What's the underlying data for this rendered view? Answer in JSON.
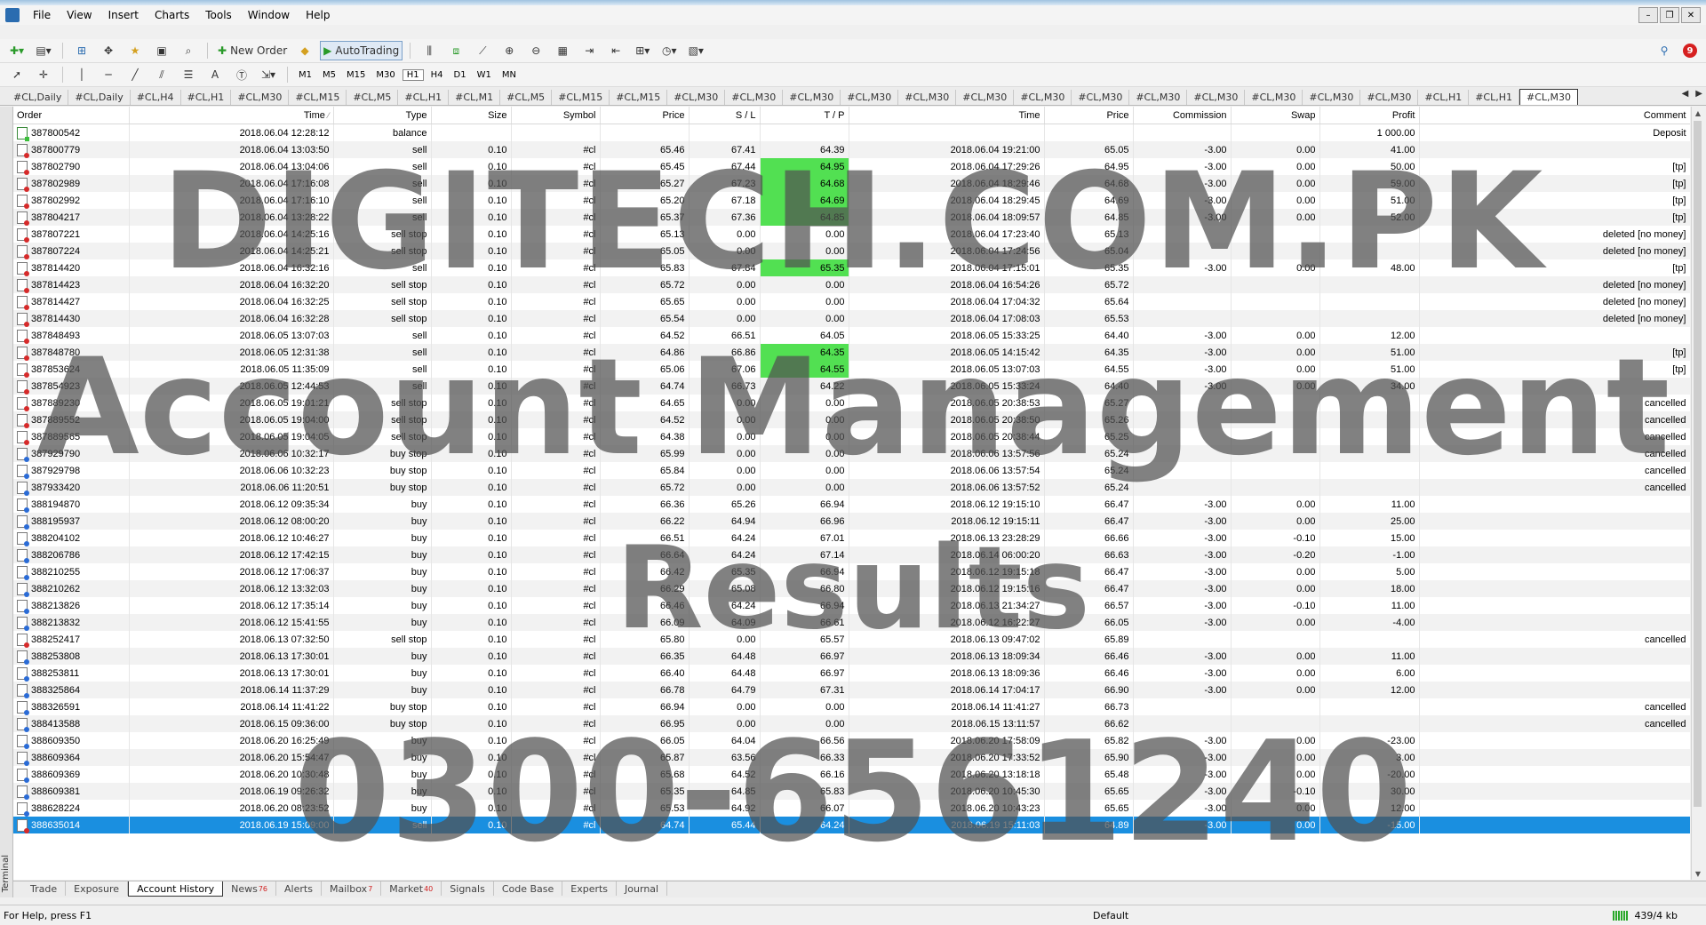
{
  "menu": [
    "File",
    "View",
    "Insert",
    "Charts",
    "Tools",
    "Window",
    "Help"
  ],
  "toolbar": {
    "new_order": "New Order",
    "autotrading": "AutoTrading",
    "notification_count": "9"
  },
  "timeframes": [
    "M1",
    "M5",
    "M15",
    "M30",
    "H1",
    "H4",
    "D1",
    "W1",
    "MN"
  ],
  "selected_timeframe": "H1",
  "chart_tabs": [
    "#CL,Daily",
    "#CL,Daily",
    "#CL,H4",
    "#CL,H1",
    "#CL,M30",
    "#CL,M15",
    "#CL,M5",
    "#CL,H1",
    "#CL,M1",
    "#CL,M5",
    "#CL,M15",
    "#CL,M15",
    "#CL,M30",
    "#CL,M30",
    "#CL,M30",
    "#CL,M30",
    "#CL,M30",
    "#CL,M30",
    "#CL,M30",
    "#CL,M30",
    "#CL,M30",
    "#CL,M30",
    "#CL,M30",
    "#CL,M30",
    "#CL,M30",
    "#CL,H1",
    "#CL,H1",
    "#CL,M30"
  ],
  "active_chart_tab": 27,
  "columns": [
    "Order",
    "Time",
    "Type",
    "Size",
    "Symbol",
    "Price",
    "S / L",
    "T / P",
    "Time",
    "Price",
    "Commission",
    "Swap",
    "Profit",
    "Comment"
  ],
  "rows": [
    {
      "order": "387800542",
      "time": "2018.06.04 12:28:12",
      "type": "balance",
      "size": "",
      "symbol": "",
      "price": "",
      "sl": "",
      "tp": "",
      "ctime": "",
      "cprice": "",
      "comm": "",
      "swap": "",
      "profit": "1 000.00",
      "comment": "Deposit"
    },
    {
      "order": "387800779",
      "time": "2018.06.04 13:03:50",
      "type": "sell",
      "size": "0.10",
      "symbol": "#cl",
      "price": "65.46",
      "sl": "67.41",
      "tp": "64.39",
      "ctime": "2018.06.04 19:21:00",
      "cprice": "65.05",
      "comm": "-3.00",
      "swap": "0.00",
      "profit": "41.00",
      "comment": ""
    },
    {
      "order": "387802790",
      "time": "2018.06.04 13:04:06",
      "type": "sell",
      "size": "0.10",
      "symbol": "#cl",
      "price": "65.45",
      "sl": "67.44",
      "tp": "64.95",
      "ctime": "2018.06.04 17:29:26",
      "cprice": "64.95",
      "comm": "-3.00",
      "swap": "0.00",
      "profit": "50.00",
      "comment": "[tp]",
      "hl": true
    },
    {
      "order": "387802989",
      "time": "2018.06.04 17:16:08",
      "type": "sell",
      "size": "0.10",
      "symbol": "#cl",
      "price": "65.27",
      "sl": "67.23",
      "tp": "64.68",
      "ctime": "2018.06.04 18:29:46",
      "cprice": "64.68",
      "comm": "-3.00",
      "swap": "0.00",
      "profit": "59.00",
      "comment": "[tp]",
      "hl": true
    },
    {
      "order": "387802992",
      "time": "2018.06.04 17:16:10",
      "type": "sell",
      "size": "0.10",
      "symbol": "#cl",
      "price": "65.20",
      "sl": "67.18",
      "tp": "64.69",
      "ctime": "2018.06.04 18:29:45",
      "cprice": "64.69",
      "comm": "-3.00",
      "swap": "0.00",
      "profit": "51.00",
      "comment": "[tp]",
      "hl": true
    },
    {
      "order": "387804217",
      "time": "2018.06.04 13:28:22",
      "type": "sell",
      "size": "0.10",
      "symbol": "#cl",
      "price": "65.37",
      "sl": "67.36",
      "tp": "64.85",
      "ctime": "2018.06.04 18:09:57",
      "cprice": "64.85",
      "comm": "-3.00",
      "swap": "0.00",
      "profit": "52.00",
      "comment": "[tp]",
      "hl": true
    },
    {
      "order": "387807221",
      "time": "2018.06.04 14:25:16",
      "type": "sell stop",
      "size": "0.10",
      "symbol": "#cl",
      "price": "65.13",
      "sl": "0.00",
      "tp": "0.00",
      "ctime": "2018.06.04 17:23:40",
      "cprice": "65.13",
      "comm": "",
      "swap": "",
      "profit": "",
      "comment": "deleted [no money]"
    },
    {
      "order": "387807224",
      "time": "2018.06.04 14:25:21",
      "type": "sell stop",
      "size": "0.10",
      "symbol": "#cl",
      "price": "65.05",
      "sl": "0.00",
      "tp": "0.00",
      "ctime": "2018.06.04 17:24:56",
      "cprice": "65.04",
      "comm": "",
      "swap": "",
      "profit": "",
      "comment": "deleted [no money]"
    },
    {
      "order": "387814420",
      "time": "2018.06.04 16:32:16",
      "type": "sell",
      "size": "0.10",
      "symbol": "#cl",
      "price": "65.83",
      "sl": "67.84",
      "tp": "65.35",
      "ctime": "2018.06.04 17:15:01",
      "cprice": "65.35",
      "comm": "-3.00",
      "swap": "0.00",
      "profit": "48.00",
      "comment": "[tp]",
      "hl": true
    },
    {
      "order": "387814423",
      "time": "2018.06.04 16:32:20",
      "type": "sell stop",
      "size": "0.10",
      "symbol": "#cl",
      "price": "65.72",
      "sl": "0.00",
      "tp": "0.00",
      "ctime": "2018.06.04 16:54:26",
      "cprice": "65.72",
      "comm": "",
      "swap": "",
      "profit": "",
      "comment": "deleted [no money]"
    },
    {
      "order": "387814427",
      "time": "2018.06.04 16:32:25",
      "type": "sell stop",
      "size": "0.10",
      "symbol": "#cl",
      "price": "65.65",
      "sl": "0.00",
      "tp": "0.00",
      "ctime": "2018.06.04 17:04:32",
      "cprice": "65.64",
      "comm": "",
      "swap": "",
      "profit": "",
      "comment": "deleted [no money]"
    },
    {
      "order": "387814430",
      "time": "2018.06.04 16:32:28",
      "type": "sell stop",
      "size": "0.10",
      "symbol": "#cl",
      "price": "65.54",
      "sl": "0.00",
      "tp": "0.00",
      "ctime": "2018.06.04 17:08:03",
      "cprice": "65.53",
      "comm": "",
      "swap": "",
      "profit": "",
      "comment": "deleted [no money]"
    },
    {
      "order": "387848493",
      "time": "2018.06.05 13:07:03",
      "type": "sell",
      "size": "0.10",
      "symbol": "#cl",
      "price": "64.52",
      "sl": "66.51",
      "tp": "64.05",
      "ctime": "2018.06.05 15:33:25",
      "cprice": "64.40",
      "comm": "-3.00",
      "swap": "0.00",
      "profit": "12.00",
      "comment": ""
    },
    {
      "order": "387848780",
      "time": "2018.06.05 12:31:38",
      "type": "sell",
      "size": "0.10",
      "symbol": "#cl",
      "price": "64.86",
      "sl": "66.86",
      "tp": "64.35",
      "ctime": "2018.06.05 14:15:42",
      "cprice": "64.35",
      "comm": "-3.00",
      "swap": "0.00",
      "profit": "51.00",
      "comment": "[tp]",
      "hl": true
    },
    {
      "order": "387853624",
      "time": "2018.06.05 11:35:09",
      "type": "sell",
      "size": "0.10",
      "symbol": "#cl",
      "price": "65.06",
      "sl": "67.06",
      "tp": "64.55",
      "ctime": "2018.06.05 13:07:03",
      "cprice": "64.55",
      "comm": "-3.00",
      "swap": "0.00",
      "profit": "51.00",
      "comment": "[tp]",
      "hl": true
    },
    {
      "order": "387854923",
      "time": "2018.06.05 12:44:53",
      "type": "sell",
      "size": "0.10",
      "symbol": "#cl",
      "price": "64.74",
      "sl": "66.73",
      "tp": "64.22",
      "ctime": "2018.06.05 15:33:24",
      "cprice": "64.40",
      "comm": "-3.00",
      "swap": "0.00",
      "profit": "34.00",
      "comment": ""
    },
    {
      "order": "387889230",
      "time": "2018.06.05 19:01:21",
      "type": "sell stop",
      "size": "0.10",
      "symbol": "#cl",
      "price": "64.65",
      "sl": "0.00",
      "tp": "0.00",
      "ctime": "2018.06.05 20:38:53",
      "cprice": "65.27",
      "comm": "",
      "swap": "",
      "profit": "",
      "comment": "cancelled"
    },
    {
      "order": "387889552",
      "time": "2018.06.05 19:04:00",
      "type": "sell stop",
      "size": "0.10",
      "symbol": "#cl",
      "price": "64.52",
      "sl": "0.00",
      "tp": "0.00",
      "ctime": "2018.06.05 20:38:50",
      "cprice": "65.26",
      "comm": "",
      "swap": "",
      "profit": "",
      "comment": "cancelled"
    },
    {
      "order": "387889565",
      "time": "2018.06.05 19:04:05",
      "type": "sell stop",
      "size": "0.10",
      "symbol": "#cl",
      "price": "64.38",
      "sl": "0.00",
      "tp": "0.00",
      "ctime": "2018.06.05 20:38:44",
      "cprice": "65.25",
      "comm": "",
      "swap": "",
      "profit": "",
      "comment": "cancelled"
    },
    {
      "order": "387929790",
      "time": "2018.06.06 10:32:17",
      "type": "buy stop",
      "size": "0.10",
      "symbol": "#cl",
      "price": "65.99",
      "sl": "0.00",
      "tp": "0.00",
      "ctime": "2018.06.06 13:57:56",
      "cprice": "65.24",
      "comm": "",
      "swap": "",
      "profit": "",
      "comment": "cancelled"
    },
    {
      "order": "387929798",
      "time": "2018.06.06 10:32:23",
      "type": "buy stop",
      "size": "0.10",
      "symbol": "#cl",
      "price": "65.84",
      "sl": "0.00",
      "tp": "0.00",
      "ctime": "2018.06.06 13:57:54",
      "cprice": "65.24",
      "comm": "",
      "swap": "",
      "profit": "",
      "comment": "cancelled"
    },
    {
      "order": "387933420",
      "time": "2018.06.06 11:20:51",
      "type": "buy stop",
      "size": "0.10",
      "symbol": "#cl",
      "price": "65.72",
      "sl": "0.00",
      "tp": "0.00",
      "ctime": "2018.06.06 13:57:52",
      "cprice": "65.24",
      "comm": "",
      "swap": "",
      "profit": "",
      "comment": "cancelled"
    },
    {
      "order": "388194870",
      "time": "2018.06.12 09:35:34",
      "type": "buy",
      "size": "0.10",
      "symbol": "#cl",
      "price": "66.36",
      "sl": "65.26",
      "tp": "66.94",
      "ctime": "2018.06.12 19:15:10",
      "cprice": "66.47",
      "comm": "-3.00",
      "swap": "0.00",
      "profit": "11.00",
      "comment": ""
    },
    {
      "order": "388195937",
      "time": "2018.06.12 08:00:20",
      "type": "buy",
      "size": "0.10",
      "symbol": "#cl",
      "price": "66.22",
      "sl": "64.94",
      "tp": "66.96",
      "ctime": "2018.06.12 19:15:11",
      "cprice": "66.47",
      "comm": "-3.00",
      "swap": "0.00",
      "profit": "25.00",
      "comment": ""
    },
    {
      "order": "388204102",
      "time": "2018.06.12 10:46:27",
      "type": "buy",
      "size": "0.10",
      "symbol": "#cl",
      "price": "66.51",
      "sl": "64.24",
      "tp": "67.01",
      "ctime": "2018.06.13 23:28:29",
      "cprice": "66.66",
      "comm": "-3.00",
      "swap": "-0.10",
      "profit": "15.00",
      "comment": ""
    },
    {
      "order": "388206786",
      "time": "2018.06.12 17:42:15",
      "type": "buy",
      "size": "0.10",
      "symbol": "#cl",
      "price": "66.64",
      "sl": "64.24",
      "tp": "67.14",
      "ctime": "2018.06.14 06:00:20",
      "cprice": "66.63",
      "comm": "-3.00",
      "swap": "-0.20",
      "profit": "-1.00",
      "comment": ""
    },
    {
      "order": "388210255",
      "time": "2018.06.12 17:06:37",
      "type": "buy",
      "size": "0.10",
      "symbol": "#cl",
      "price": "66.42",
      "sl": "65.35",
      "tp": "66.94",
      "ctime": "2018.06.12 19:15:18",
      "cprice": "66.47",
      "comm": "-3.00",
      "swap": "0.00",
      "profit": "5.00",
      "comment": ""
    },
    {
      "order": "388210262",
      "time": "2018.06.12 13:32:03",
      "type": "buy",
      "size": "0.10",
      "symbol": "#cl",
      "price": "66.29",
      "sl": "65.08",
      "tp": "66.80",
      "ctime": "2018.06.12 19:15:16",
      "cprice": "66.47",
      "comm": "-3.00",
      "swap": "0.00",
      "profit": "18.00",
      "comment": ""
    },
    {
      "order": "388213826",
      "time": "2018.06.12 17:35:14",
      "type": "buy",
      "size": "0.10",
      "symbol": "#cl",
      "price": "66.46",
      "sl": "64.24",
      "tp": "66.94",
      "ctime": "2018.06.13 21:34:27",
      "cprice": "66.57",
      "comm": "-3.00",
      "swap": "-0.10",
      "profit": "11.00",
      "comment": ""
    },
    {
      "order": "388213832",
      "time": "2018.06.12 15:41:55",
      "type": "buy",
      "size": "0.10",
      "symbol": "#cl",
      "price": "66.09",
      "sl": "64.09",
      "tp": "66.61",
      "ctime": "2018.06.12 16:22:27",
      "cprice": "66.05",
      "comm": "-3.00",
      "swap": "0.00",
      "profit": "-4.00",
      "comment": ""
    },
    {
      "order": "388252417",
      "time": "2018.06.13 07:32:50",
      "type": "sell stop",
      "size": "0.10",
      "symbol": "#cl",
      "price": "65.80",
      "sl": "0.00",
      "tp": "65.57",
      "ctime": "2018.06.13 09:47:02",
      "cprice": "65.89",
      "comm": "",
      "swap": "",
      "profit": "",
      "comment": "cancelled"
    },
    {
      "order": "388253808",
      "time": "2018.06.13 17:30:01",
      "type": "buy",
      "size": "0.10",
      "symbol": "#cl",
      "price": "66.35",
      "sl": "64.48",
      "tp": "66.97",
      "ctime": "2018.06.13 18:09:34",
      "cprice": "66.46",
      "comm": "-3.00",
      "swap": "0.00",
      "profit": "11.00",
      "comment": ""
    },
    {
      "order": "388253811",
      "time": "2018.06.13 17:30:01",
      "type": "buy",
      "size": "0.10",
      "symbol": "#cl",
      "price": "66.40",
      "sl": "64.48",
      "tp": "66.97",
      "ctime": "2018.06.13 18:09:36",
      "cprice": "66.46",
      "comm": "-3.00",
      "swap": "0.00",
      "profit": "6.00",
      "comment": ""
    },
    {
      "order": "388325864",
      "time": "2018.06.14 11:37:29",
      "type": "buy",
      "size": "0.10",
      "symbol": "#cl",
      "price": "66.78",
      "sl": "64.79",
      "tp": "67.31",
      "ctime": "2018.06.14 17:04:17",
      "cprice": "66.90",
      "comm": "-3.00",
      "swap": "0.00",
      "profit": "12.00",
      "comment": ""
    },
    {
      "order": "388326591",
      "time": "2018.06.14 11:41:22",
      "type": "buy stop",
      "size": "0.10",
      "symbol": "#cl",
      "price": "66.94",
      "sl": "0.00",
      "tp": "0.00",
      "ctime": "2018.06.14 11:41:27",
      "cprice": "66.73",
      "comm": "",
      "swap": "",
      "profit": "",
      "comment": "cancelled"
    },
    {
      "order": "388413588",
      "time": "2018.06.15 09:36:00",
      "type": "buy stop",
      "size": "0.10",
      "symbol": "#cl",
      "price": "66.95",
      "sl": "0.00",
      "tp": "0.00",
      "ctime": "2018.06.15 13:11:57",
      "cprice": "66.62",
      "comm": "",
      "swap": "",
      "profit": "",
      "comment": "cancelled"
    },
    {
      "order": "388609350",
      "time": "2018.06.20 16:25:49",
      "type": "buy",
      "size": "0.10",
      "symbol": "#cl",
      "price": "66.05",
      "sl": "64.04",
      "tp": "66.56",
      "ctime": "2018.06.20 17:58:09",
      "cprice": "65.82",
      "comm": "-3.00",
      "swap": "0.00",
      "profit": "-23.00",
      "comment": ""
    },
    {
      "order": "388609364",
      "time": "2018.06.20 15:54:47",
      "type": "buy",
      "size": "0.10",
      "symbol": "#cl",
      "price": "65.87",
      "sl": "63.56",
      "tp": "66.33",
      "ctime": "2018.06.20 17:33:52",
      "cprice": "65.90",
      "comm": "-3.00",
      "swap": "0.00",
      "profit": "3.00",
      "comment": ""
    },
    {
      "order": "388609369",
      "time": "2018.06.20 10:30:48",
      "type": "buy",
      "size": "0.10",
      "symbol": "#cl",
      "price": "65.68",
      "sl": "64.52",
      "tp": "66.16",
      "ctime": "2018.06.20 13:18:18",
      "cprice": "65.48",
      "comm": "-3.00",
      "swap": "0.00",
      "profit": "-20.00",
      "comment": ""
    },
    {
      "order": "388609381",
      "time": "2018.06.19 09:26:32",
      "type": "buy",
      "size": "0.10",
      "symbol": "#cl",
      "price": "65.35",
      "sl": "64.85",
      "tp": "65.83",
      "ctime": "2018.06.20 10:45:30",
      "cprice": "65.65",
      "comm": "-3.00",
      "swap": "-0.10",
      "profit": "30.00",
      "comment": ""
    },
    {
      "order": "388628224",
      "time": "2018.06.20 08:23:52",
      "type": "buy",
      "size": "0.10",
      "symbol": "#cl",
      "price": "65.53",
      "sl": "64.92",
      "tp": "66.07",
      "ctime": "2018.06.20 10:43:23",
      "cprice": "65.65",
      "comm": "-3.00",
      "swap": "0.00",
      "profit": "12.00",
      "comment": ""
    },
    {
      "order": "388635014",
      "time": "2018.06.19 15:09:00",
      "type": "sell",
      "size": "0.10",
      "symbol": "#cl",
      "price": "64.74",
      "sl": "65.44",
      "tp": "64.24",
      "ctime": "2018.06.19 15:11:03",
      "cprice": "64.89",
      "comm": "-3.00",
      "swap": "0.00",
      "profit": "-15.00",
      "comment": "",
      "selected": true
    }
  ],
  "bottom_tabs": [
    {
      "label": "Trade",
      "badge": ""
    },
    {
      "label": "Exposure",
      "badge": ""
    },
    {
      "label": "Account History",
      "badge": ""
    },
    {
      "label": "News",
      "badge": "76"
    },
    {
      "label": "Alerts",
      "badge": ""
    },
    {
      "label": "Mailbox",
      "badge": "7"
    },
    {
      "label": "Market",
      "badge": "40"
    },
    {
      "label": "Signals",
      "badge": ""
    },
    {
      "label": "Code Base",
      "badge": ""
    },
    {
      "label": "Experts",
      "badge": ""
    },
    {
      "label": "Journal",
      "badge": ""
    }
  ],
  "active_bottom_tab": 2,
  "terminal_label": "Terminal",
  "status": {
    "help": "For Help, press F1",
    "profile": "Default",
    "traffic": "439/4 kb"
  },
  "watermark": [
    "DIGITECH.COM.PK",
    "Account Management",
    "Results",
    "0300-6561240"
  ],
  "colors": {
    "tp_highlight": "#52e052",
    "selected_row": "#1a8fe0"
  }
}
